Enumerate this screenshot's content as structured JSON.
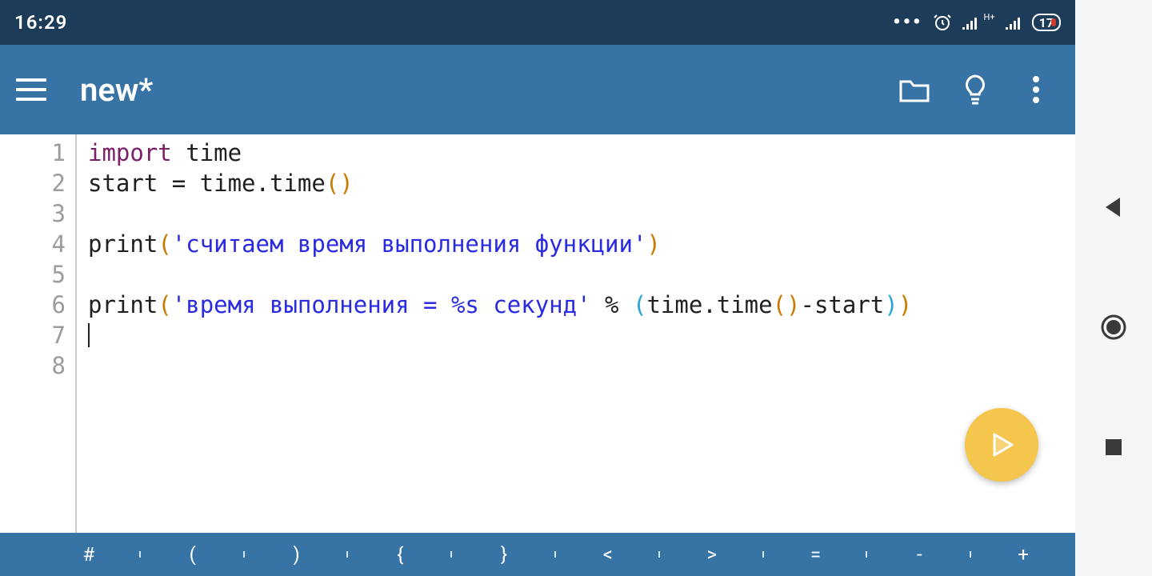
{
  "status": {
    "time": "16:29",
    "battery": "17",
    "network_label": "H+"
  },
  "appbar": {
    "title": "new*",
    "icons": {
      "menu": "menu-icon",
      "folder": "folder-icon",
      "bulb": "bulb-icon",
      "overflow": "overflow-icon"
    }
  },
  "editor": {
    "line_numbers": [
      "1",
      "2",
      "3",
      "4",
      "5",
      "6",
      "7",
      "8"
    ],
    "lines": [
      {
        "tokens": [
          {
            "t": "import",
            "c": "kw"
          },
          {
            "t": " time",
            "c": ""
          }
        ]
      },
      {
        "tokens": [
          {
            "t": "start = time.time",
            "c": ""
          },
          {
            "t": "()",
            "c": "paren1"
          }
        ]
      },
      {
        "tokens": []
      },
      {
        "tokens": [
          {
            "t": "print",
            "c": ""
          },
          {
            "t": "(",
            "c": "paren1"
          },
          {
            "t": "'считаем время выполнения функции'",
            "c": "str"
          },
          {
            "t": ")",
            "c": "paren1"
          }
        ]
      },
      {
        "tokens": []
      },
      {
        "tokens": [
          {
            "t": "print",
            "c": ""
          },
          {
            "t": "(",
            "c": "paren1"
          },
          {
            "t": "'время выполнения = %s секунд'",
            "c": "str"
          },
          {
            "t": " % ",
            "c": ""
          },
          {
            "t": "(",
            "c": "paren2"
          },
          {
            "t": "time.time",
            "c": ""
          },
          {
            "t": "()",
            "c": "paren1"
          },
          {
            "t": "-start",
            "c": ""
          },
          {
            "t": ")",
            "c": "paren2"
          },
          {
            "t": ")",
            "c": "paren1"
          }
        ]
      },
      {
        "tokens": [],
        "cursor": true
      },
      {
        "tokens": []
      }
    ]
  },
  "symbol_bar": {
    "keys": [
      "",
      "#",
      "(",
      ")",
      "{",
      "}",
      "<",
      ">",
      "=",
      "-",
      "+"
    ]
  },
  "fab": {
    "label": "run"
  },
  "side_nav": {
    "back": "back-icon",
    "home": "home-icon",
    "recents": "recents-icon"
  }
}
